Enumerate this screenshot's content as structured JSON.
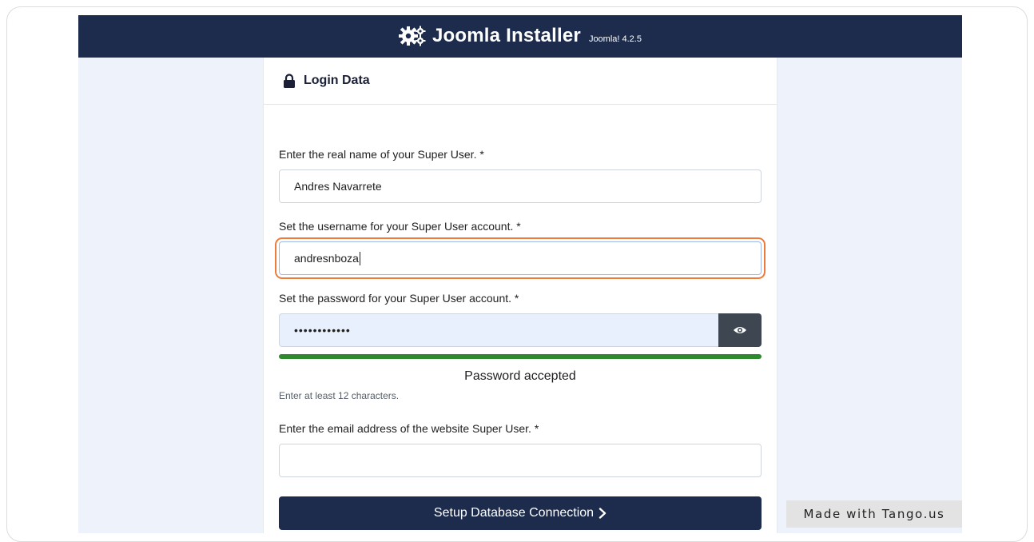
{
  "header": {
    "title": "Joomla Installer",
    "version": "Joomla! 4.2.5",
    "icon": "gears-icon"
  },
  "card": {
    "title": "Login Data",
    "icon": "lock-icon"
  },
  "form": {
    "real_name_label": "Enter the real name of your Super User. *",
    "real_name_value": "Andres Navarrete",
    "username_label": "Set the username for your Super User account. *",
    "username_value": "andresnboza",
    "password_label": "Set the password for your Super User account. *",
    "password_value": "••••••••••••",
    "password_strength": 1.0,
    "password_status": "Password accepted",
    "password_hint": "Enter at least 12 characters.",
    "email_label": "Enter the email address of the website Super User. *",
    "email_value": "",
    "submit_label": "Setup Database Connection"
  },
  "watermark": "Made with Tango.us",
  "colors": {
    "header_bg": "#1d2c4c",
    "page_bg": "#eef2fb",
    "focus_ring": "#f07a3a",
    "strength_ok": "#2f8a2f"
  }
}
